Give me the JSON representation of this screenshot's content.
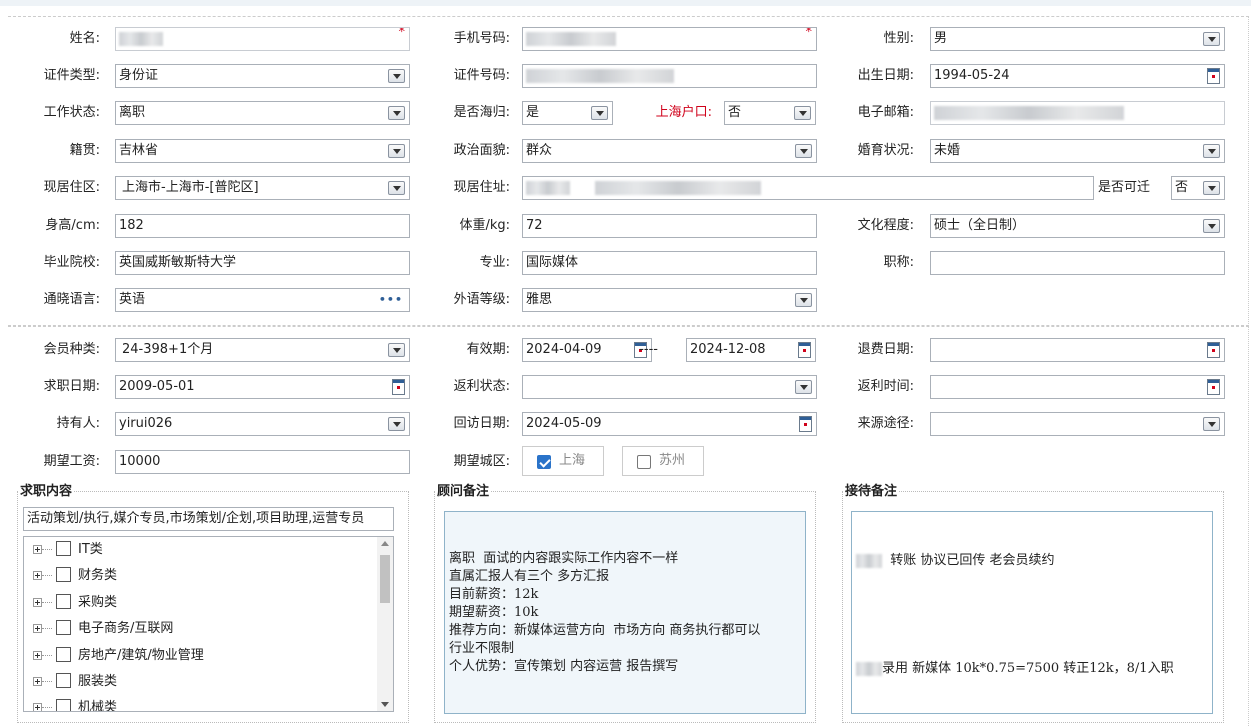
{
  "section1": {
    "name_label": "姓名:",
    "phone_label": "手机号码:",
    "gender_label": "性别:",
    "gender_value": "男",
    "idtype_label": "证件类型:",
    "idtype_value": "身份证",
    "idno_label": "证件号码:",
    "birth_label": "出生日期:",
    "birth_value": "1994-05-24",
    "workstatus_label": "工作状态:",
    "workstatus_value": "离职",
    "returnee_label": "是否海归:",
    "returnee_value": "是",
    "hukou_label": "上海户口:",
    "hukou_value": "否",
    "email_label": "电子邮箱:",
    "native_label": "籍贯:",
    "native_value": "吉林省",
    "political_label": "政治面貌:",
    "political_value": "群众",
    "marital_label": "婚育状况:",
    "marital_value": "未婚",
    "district_label": "现居住区:",
    "district_value": "上海市-上海市-[普陀区]",
    "address_label": "现居住址:",
    "relocate_label": "是否可迁",
    "relocate_value": "否",
    "height_label": "身高/cm:",
    "height_value": "182",
    "weight_label": "体重/kg:",
    "weight_value": "72",
    "edu_label": "文化程度:",
    "edu_value": "硕士（全日制）",
    "school_label": "毕业院校:",
    "school_value": "英国威斯敏斯特大学",
    "major_label": "专业:",
    "major_value": "国际媒体",
    "title_label": "职称:",
    "title_value": "",
    "lang_label": "通晓语言:",
    "lang_value": "英语",
    "langlevel_label": "外语等级:",
    "langlevel_value": "雅思"
  },
  "section2": {
    "member_label": "会员种类:",
    "member_value": "24-398+1个月",
    "valid_label": "有效期:",
    "valid_from": "2024-04-09",
    "valid_sep": "----",
    "valid_to": "2024-12-08",
    "refund_label": "退费日期:",
    "refund_value": "",
    "jobdate_label": "求职日期:",
    "jobdate_value": "2009-05-01",
    "rebate_status_label": "返利状态:",
    "rebate_status_value": "",
    "rebate_time_label": "返利时间:",
    "rebate_time_value": "",
    "holder_label": "持有人:",
    "holder_value": "yirui026",
    "visit_label": "回访日期:",
    "visit_value": "2024-05-09",
    "source_label": "来源途径:",
    "source_value": "",
    "salary_label": "期望工资:",
    "salary_value": "10000",
    "city_label": "期望城区:",
    "city_options": [
      {
        "label": "上海",
        "checked": true
      },
      {
        "label": "苏州",
        "checked": false
      }
    ]
  },
  "job_panel": {
    "title": "求职内容",
    "summary": "活动策划/执行,媒介专员,市场策划/企划,项目助理,运营专员",
    "tree_items": [
      "IT类",
      "财务类",
      "采购类",
      "电子商务/互联网",
      "房地产/建筑/物业管理",
      "服装类",
      "机械类"
    ]
  },
  "advisor_panel": {
    "title": "顾问备注",
    "text": "\n\n离职  面试的内容跟实际工作内容不一样\n直属汇报人有三个 多方汇报\n目前薪资：12k\n期望薪资：10k\n推荐方向：新媒体运营方向  市场方向 商务执行都可以\n行业不限制\n个人优势：宣传策划 内容运营 报告撰写"
  },
  "reception_panel": {
    "title": "接待备注",
    "line1": "转账 协议已回传 老会员续约",
    "line2": "录用 新媒体 10k*0.75=7500 转正12k，8/1入职"
  }
}
